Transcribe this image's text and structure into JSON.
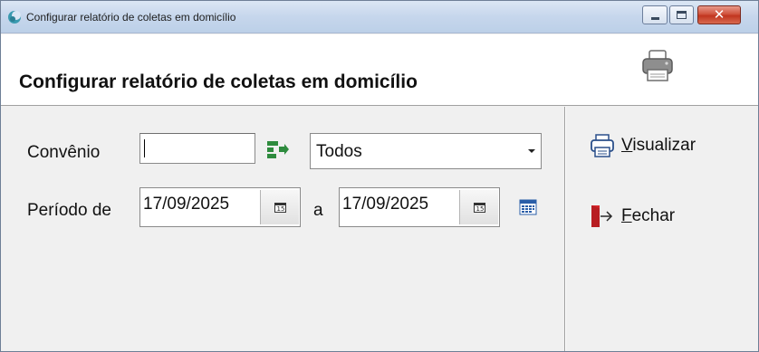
{
  "window": {
    "title": "Configurar relatório de coletas em domicílio",
    "controls": {
      "minimize": "–",
      "maximize": "□",
      "close": "✕"
    }
  },
  "header": {
    "title": "Configurar relatório de coletas em domicílio",
    "print_icon": "printer-icon"
  },
  "form": {
    "convenio": {
      "label": "Convênio",
      "code_value": "",
      "lookup_icon": "lookup-arrow-icon",
      "selected_option": "Todos"
    },
    "periodo": {
      "label_from": "Período de",
      "from_value": "17/09/2025",
      "label_to": "a",
      "to_value": "17/09/2025",
      "date_button_glyph": "15",
      "calendar_icon": "calendar-icon"
    }
  },
  "actions": {
    "visualizar": {
      "mnemonic": "V",
      "rest": "isualizar",
      "icon": "printer-icon"
    },
    "fechar": {
      "mnemonic": "F",
      "rest": "echar",
      "icon": "exit-door-icon"
    }
  },
  "colors": {
    "accent_green": "#2e8b3e",
    "icon_blue": "#2a5ea8",
    "exit_red": "#d9262b",
    "title_bar": "#c6d6ec"
  }
}
